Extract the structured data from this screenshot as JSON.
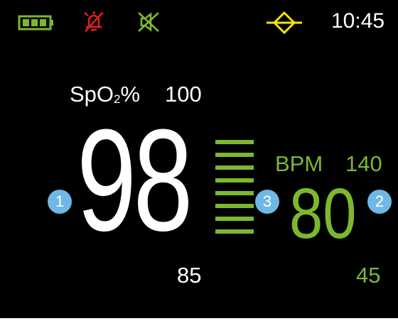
{
  "status_bar": {
    "clock": "10:45",
    "battery_icon": "battery-full-icon",
    "alarm_icon": "alarm-off-icon",
    "sound_icon": "sound-muted-icon",
    "bluetooth_icon": "bluetooth-icon"
  },
  "spo2": {
    "label_main": "SpO",
    "label_sub": "2",
    "label_suffix": "%",
    "high_limit": "100",
    "value": "98",
    "low_limit": "85"
  },
  "pulse_bar": {
    "segments_lit": 8,
    "segments_total": 8
  },
  "bpm": {
    "label": "BPM",
    "high_limit": "140",
    "value": "80",
    "low_limit": "45"
  },
  "callouts": {
    "one": "1",
    "two": "2",
    "three": "3"
  },
  "colors": {
    "background": "#000000",
    "spo2": "#ffffff",
    "bpm": "#7cb82f",
    "battery": "#7cb82f",
    "alarm_off": "#e02020",
    "sound_off": "#7cb82f",
    "bluetooth": "#f2e600",
    "callout": "#6fb8e6"
  }
}
